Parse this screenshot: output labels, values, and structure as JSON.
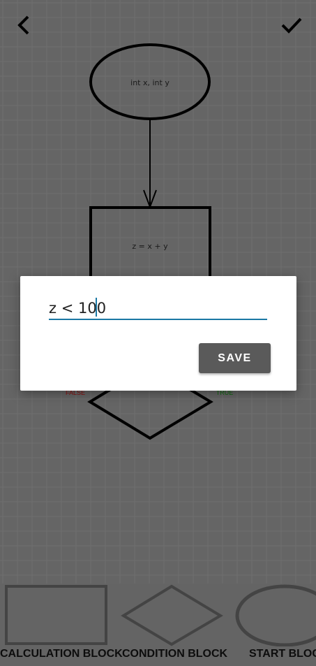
{
  "toolbar": {
    "back_icon": "chevron-left-icon",
    "confirm_icon": "check-icon"
  },
  "flowchart": {
    "start_block": {
      "text": "int x, int y"
    },
    "calc_block": {
      "text": "z = x + y"
    },
    "condition_block": {
      "false_label": "FALSE",
      "true_label": "TRUE"
    },
    "colors": {
      "false": "#8b1010",
      "true": "#0e6a0e"
    }
  },
  "dialog": {
    "input_value": "z < 100",
    "save_label": "SAVE",
    "accent": "#1b78a4"
  },
  "palette": {
    "items": [
      {
        "label": "CALCULATION BLOCK"
      },
      {
        "label": "CONDITION BLOCK"
      },
      {
        "label": "START BLOCK"
      }
    ]
  }
}
